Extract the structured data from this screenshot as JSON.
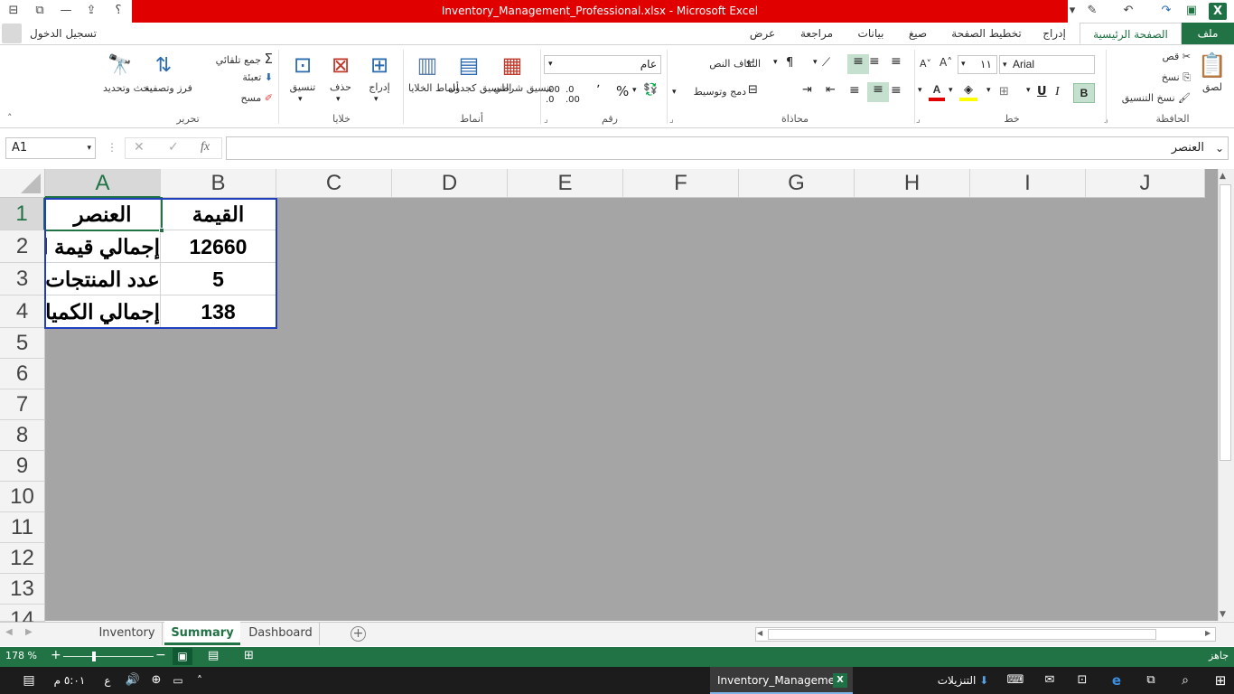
{
  "window": {
    "title": "Inventory_Management_Professional.xlsx -  Microsoft Excel",
    "signin": "تسجيل الدخول",
    "help": "؟"
  },
  "tabs": [
    "ملف",
    "الصفحة الرئيسية",
    "إدراج",
    "تخطيط الصفحة",
    "صيغ",
    "بيانات",
    "مراجعة",
    "عرض"
  ],
  "ribbon": {
    "clipboard": {
      "label": "الحافظة",
      "paste": "لصق",
      "cut": "قص",
      "copy": "نسخ",
      "format_painter": "نسخ التنسيق"
    },
    "font": {
      "label": "خط",
      "name": "Arial",
      "size": "١١",
      "bold": "B",
      "italic": "I",
      "underline": "U"
    },
    "alignment": {
      "label": "محاذاة",
      "wrap": "التفاف النص",
      "merge": "دمج وتوسيط"
    },
    "number": {
      "label": "رقم",
      "format": "عام"
    },
    "styles": {
      "label": "أنماط",
      "conditional": "تنسيق شرطي",
      "table": "التنسيق كجدول",
      "cell_styles": "أنماط الخلايا"
    },
    "cells": {
      "label": "خلايا",
      "insert": "إدراج",
      "delete": "حذف",
      "format": "تنسيق"
    },
    "editing": {
      "label": "تحرير",
      "autosum": "جمع تلقائي",
      "fill": "تعبئة",
      "clear": "مسح",
      "sort": "فرز وتصفية",
      "find": "بحث وتحديد"
    }
  },
  "formula_bar": {
    "name_box": "A1",
    "fx": "fx",
    "content": "العنصر"
  },
  "columns": [
    "A",
    "B",
    "C",
    "D",
    "E",
    "F",
    "G",
    "H",
    "I",
    "J"
  ],
  "rows": [
    "1",
    "2",
    "3",
    "4",
    "5",
    "6",
    "7",
    "8",
    "9",
    "10",
    "11",
    "12",
    "13",
    "14"
  ],
  "cells": {
    "A1": "العنصر",
    "B1": "القيمة",
    "A2": "إجمالي قيمة المخزون",
    "B2": "12660",
    "A3": "عدد المنتجات",
    "B3": "5",
    "A4": "إجمالي الكميات",
    "B4": "138"
  },
  "sheets": [
    "Inventory",
    "Summary",
    "Dashboard"
  ],
  "active_sheet": "Summary",
  "status": {
    "ready": "جاهز",
    "zoom": "178 %"
  },
  "taskbar": {
    "app": "Inventory_Manageme...",
    "downloads": "التنزيلات",
    "time": "٥:٠١ م",
    "lang": "ع"
  },
  "colors": {
    "excel_green": "#217346",
    "title_red": "#e00000",
    "grid_gray": "#a5a5a5",
    "selection_blue": "#1f3fbf"
  }
}
